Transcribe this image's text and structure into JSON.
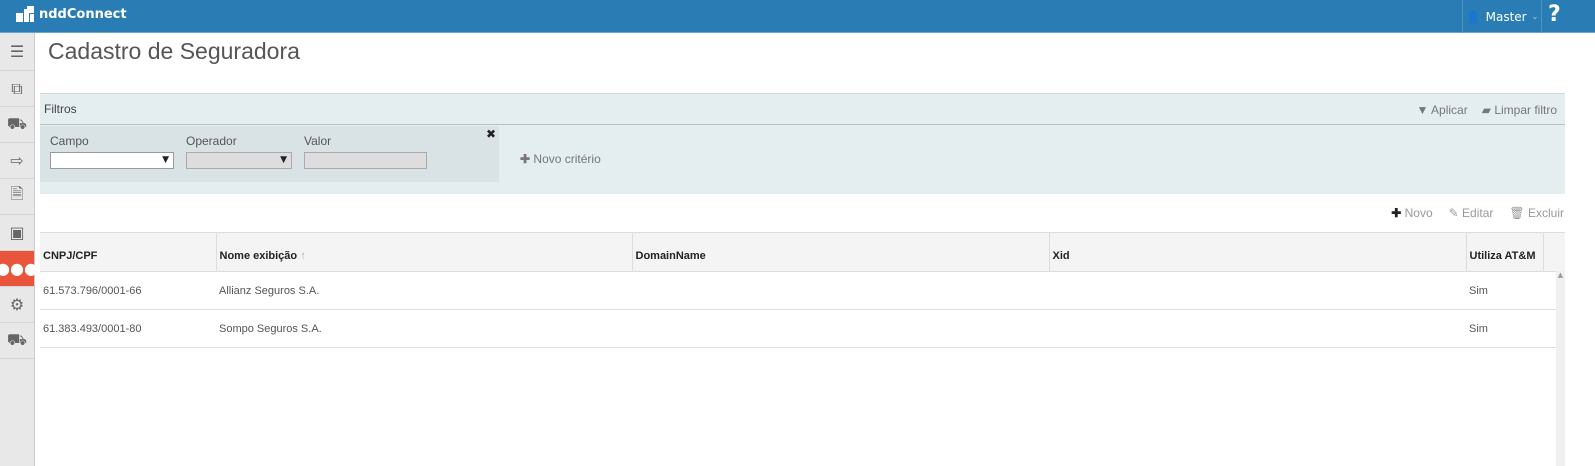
{
  "app": {
    "name": "nddConnect",
    "user": "Master",
    "help": "?"
  },
  "sidebar": {
    "items": [
      {
        "icon": "menu-icon"
      },
      {
        "icon": "documents-icon"
      },
      {
        "icon": "truck-icon"
      },
      {
        "icon": "export-icon"
      },
      {
        "icon": "file-icon"
      },
      {
        "icon": "money-icon"
      },
      {
        "icon": "users-icon",
        "active": true
      },
      {
        "icon": "gears-icon"
      },
      {
        "icon": "truck-icon"
      }
    ]
  },
  "page": {
    "title": "Cadastro de Seguradora"
  },
  "filters": {
    "title": "Filtros",
    "apply": "Aplicar",
    "clear": "Limpar filtro",
    "field_label": "Campo",
    "operator_label": "Operador",
    "value_label": "Valor",
    "new_criterion": "Novo critério"
  },
  "toolbar": {
    "new": "Novo",
    "edit": "Editar",
    "delete": "Excluir"
  },
  "table": {
    "columns": [
      "CNPJ/CPF",
      "Nome exibição",
      "DomainName",
      "Xid",
      "Utiliza AT&M"
    ],
    "rows": [
      [
        "61.573.796/0001-66",
        "Allianz Seguros S.A.",
        "",
        "",
        "Sim"
      ],
      [
        "61.383.493/0001-80",
        "Sompo Seguros S.A.",
        "",
        "",
        "Sim"
      ]
    ]
  },
  "colors": {
    "topbar": "#2a7cb4",
    "active": "#e8553a"
  }
}
